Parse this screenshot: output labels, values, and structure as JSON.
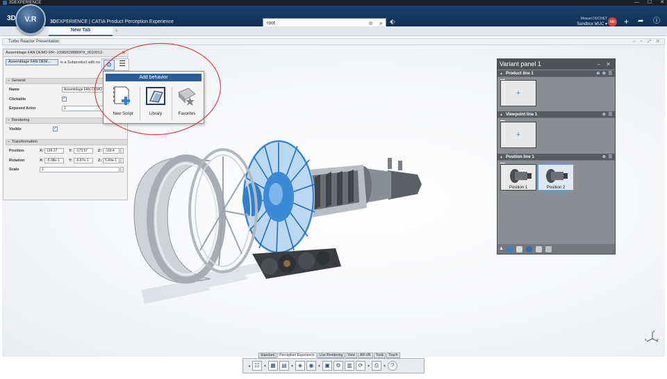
{
  "window": {
    "title": "3DEXPERIENCE",
    "controls": [
      "—",
      "☐",
      "✕"
    ]
  },
  "header": {
    "brand": "3DS",
    "compass_label": "V.R",
    "app_title_bold": "3D",
    "app_title": "EXPERIENCE | CATIA Product Perception Experience",
    "search_value": "root",
    "user_name": "Mosuel DUCHET",
    "workspace": "Sandbox MUC",
    "avatar_initials": "MD",
    "icons": [
      "compass-icon",
      "tag-icon",
      "plus-icon",
      "share-icon",
      "help-icon"
    ]
  },
  "tabs": {
    "active": "New Tab",
    "add": "+"
  },
  "viewer": {
    "title": "Turbo Reactor Presentation"
  },
  "properties": {
    "title": "Assemblage FAN DEMO RR--19382038880PX_0010012-",
    "object_button": "Assemblage FAN DEM...",
    "subtitle": "is a Subproduct with no",
    "sections": {
      "general": "General",
      "rendering": "Rendering",
      "transformation": "Transformation"
    },
    "labels": {
      "name": "Name",
      "clickable": "Clickable",
      "exposed_actor": "Exposed Actor",
      "visible": "Visible",
      "position": "Position",
      "rotation": "Rotation",
      "scale": "Scale"
    },
    "name_value": "Assemblage FAN DEMO",
    "exposed_actor_value": "1",
    "clickable": true,
    "visible": true,
    "position": {
      "x": "139.27",
      "y": "-173.57",
      "z": "-118.4"
    },
    "rotation": {
      "x": "-5.08e-1",
      "y": "-6.87e-1",
      "z": "5.49e-1"
    },
    "scale_value": "1",
    "axis": {
      "x": "X:",
      "y": "Y:",
      "z": "Z:"
    }
  },
  "add_behavior": {
    "title": "Add behavior",
    "items": [
      "New Script",
      "Library",
      "Favorites"
    ]
  },
  "variant_panel": {
    "title": "Variant panel 1",
    "lines": [
      "Product line 1",
      "Viewpoint line 1",
      "Position line 1"
    ],
    "positions": [
      "Position 1",
      "Position 2"
    ],
    "slot_add": "+"
  },
  "action_bar": {
    "tabs": [
      "Standard",
      "Perception Experience",
      "Live Rendering",
      "View",
      "AR-VR",
      "Tools",
      "Touch"
    ],
    "active_tab": "Perception Experience",
    "help": "?"
  },
  "axis_triad": {
    "x": "x",
    "y": "y",
    "z": "z"
  },
  "colors": {
    "header": "#103058",
    "accent": "#2a5d9a",
    "annotation": "#d0292c",
    "engine_highlight": "#3a8ad6"
  }
}
